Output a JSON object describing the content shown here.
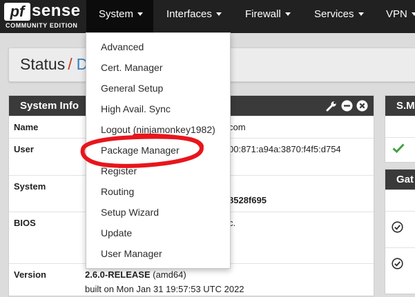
{
  "logo": {
    "pf": "pf",
    "sense": "sense",
    "edition": "COMMUNITY EDITION"
  },
  "nav": {
    "items": [
      {
        "label": "System"
      },
      {
        "label": "Interfaces"
      },
      {
        "label": "Firewall"
      },
      {
        "label": "Services"
      },
      {
        "label": "VPN"
      }
    ]
  },
  "breadcrumb": {
    "section": "Status",
    "separator": "/",
    "page": "D"
  },
  "system_info": {
    "title": "System Info",
    "rows": [
      {
        "label": "Name",
        "value": "com"
      },
      {
        "label": "User",
        "value": "00:871:a94a:3870:f4f5:d754"
      },
      {
        "label": "System",
        "value": "8528f695"
      },
      {
        "label": "BIOS",
        "value": "c."
      },
      {
        "label": "Version",
        "value": "2.6.0-RELEASE",
        "value_suffix": "(amd64)",
        "value2": "built on Mon Jan 31 19:57:53 UTC 2022"
      }
    ]
  },
  "right_panels": {
    "smart_title": "S.M",
    "gateways_title": "Gat"
  },
  "system_menu": {
    "items": [
      "Advanced",
      "Cert. Manager",
      "General Setup",
      "High Avail. Sync",
      "Logout (ninjamonkey1982)",
      "Package Manager",
      "Register",
      "Routing",
      "Setup Wizard",
      "Update",
      "User Manager"
    ],
    "highlighted": "Package Manager"
  },
  "colors": {
    "navbar": "#212121",
    "panel_header": "#3a3a3a",
    "annotation": "#e8151c",
    "success": "#3fa143",
    "link": "#3a7fbf",
    "separator": "#c0392b"
  },
  "icons": [
    "wrench-icon",
    "minus-circle-icon",
    "close-circle-icon",
    "check-icon",
    "check-circle-icon",
    "caret-down-icon"
  ]
}
